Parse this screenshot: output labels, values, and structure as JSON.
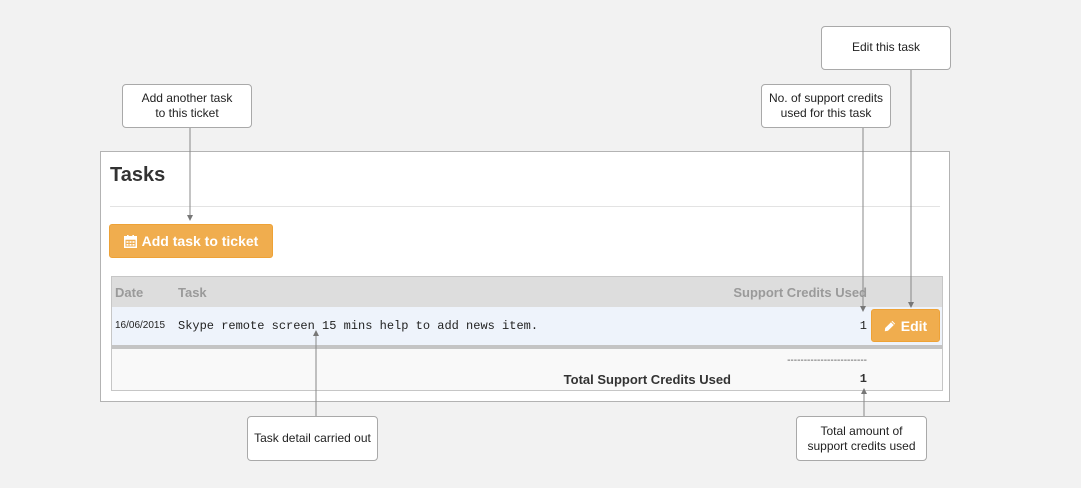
{
  "callouts": {
    "add_task": [
      "Add another task",
      "to this ticket"
    ],
    "support_credits": [
      "No. of support credits",
      "used for this task"
    ],
    "edit_task": [
      "Edit this task"
    ],
    "task_detail": [
      "Task detail carried out"
    ],
    "total_amount": [
      "Total amount of",
      "support credits used"
    ]
  },
  "panel": {
    "title": "Tasks",
    "add_button_label": "Add task to ticket",
    "add_button_icon": "calendar-icon"
  },
  "table": {
    "headers": {
      "date": "Date",
      "task": "Task",
      "credits": "Support Credits Used"
    },
    "rows": [
      {
        "date": "16/06/2015",
        "task": "Skype remote screen 15 mins help to add news item.",
        "credits": "1",
        "edit_label": "Edit",
        "edit_icon": "pencil-icon"
      }
    ],
    "separator": "------------------------",
    "total_label": "Total Support Credits Used",
    "total_value": "1"
  },
  "colors": {
    "accent": "#f0ad4e",
    "row_highlight": "#eef3fb",
    "header_bg": "#dddddd"
  }
}
